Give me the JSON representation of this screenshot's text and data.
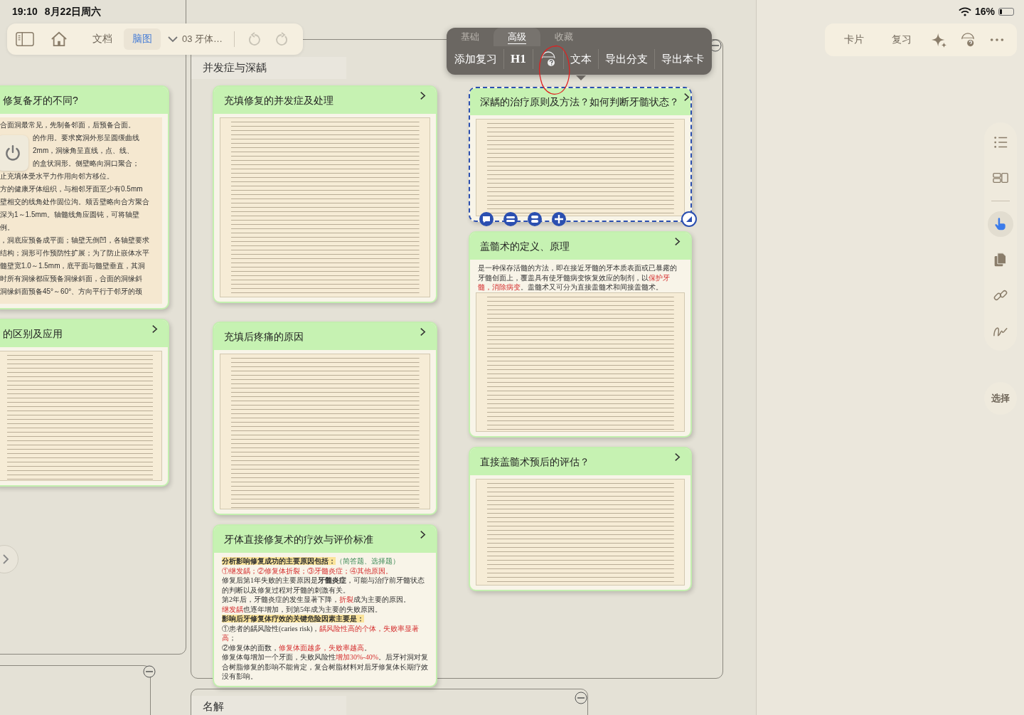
{
  "status_bar": {
    "time": "19:10",
    "date": "8月22日周六",
    "battery": "16%"
  },
  "toolbar": {
    "tabs": [
      {
        "label": "文档",
        "selected": false
      },
      {
        "label": "脑图",
        "selected": true
      }
    ],
    "document": "03 牙体…"
  },
  "format_popup": {
    "tabs": [
      {
        "label": "基础",
        "selected": false
      },
      {
        "label": "高级",
        "selected": true
      },
      {
        "label": "收藏",
        "selected": false
      }
    ],
    "actions": [
      {
        "kind": "text",
        "label": "添加复习"
      },
      {
        "kind": "heading",
        "label": "H1"
      },
      {
        "kind": "web"
      },
      {
        "kind": "text",
        "label": "文本"
      },
      {
        "kind": "text",
        "label": "导出分支"
      },
      {
        "kind": "text",
        "label": "导出本卡"
      }
    ]
  },
  "right_toolbar": {
    "buttons": [
      "卡片",
      "复习"
    ]
  },
  "side_tools": [
    {
      "kind": "list",
      "selected": false
    },
    {
      "kind": "layout",
      "selected": false
    },
    {
      "kind": "pointer",
      "selected": true
    },
    {
      "kind": "pages",
      "selected": false
    },
    {
      "kind": "link",
      "selected": false
    },
    {
      "kind": "draw",
      "selected": false
    }
  ],
  "select_button": "选择",
  "groups": [
    {
      "title": "并发症与深龋"
    },
    {
      "title": "名解"
    }
  ],
  "cards": [
    {
      "title": "修复备牙的不同?",
      "selected": false,
      "chevron": false,
      "kind": "lines",
      "lines": [
        "合面洞最常见，先制备邻面，后预备合面。",
        "的作用。要求窝洞外形呈圆缓曲线",
        "2mm，洞缘角呈直线，点、线、",
        "的盒状洞形。侧壁略向洞口聚合；",
        "止充填体受水平力作用向邻方移位。",
        "方的健康牙体组织，与相邻牙面至少有0.5mm",
        "壁相交的线角处作固位沟。颊舌壁略向合方聚合",
        "深为1～1.5mm。轴髓线角应圆钝，可将轴壁",
        "例。",
        "，洞底应预备成平面；轴壁无倒凹，各轴壁要求",
        "结构；洞形可作预防性扩展；为了防止嵌体水平",
        "髓壁宽1.0～1.5mm，底平面与髓壁垂直，其洞",
        "时所有洞缘都应预备洞缘斜面，合面的洞缘斜",
        "洞缘斜面预备45°～60°、方向平行于邻牙的颈"
      ]
    },
    {
      "title": "的区别及应用",
      "selected": false,
      "chevron": true,
      "kind": "document"
    },
    {
      "title": "充填修复的并发症及处理",
      "selected": false,
      "chevron": true,
      "kind": "document"
    },
    {
      "title": "充填后疼痛的原因",
      "selected": false,
      "chevron": true,
      "kind": "document"
    },
    {
      "title": "牙体直接修复术的疗效与评价标准",
      "selected": false,
      "chevron": true,
      "kind": "rich",
      "paragraphs": [
        [
          {
            "kind": "mark",
            "text": "分析影响修复成功的主要原因包括："
          },
          {
            "kind": "green",
            "text": "（简答题、选择题）"
          }
        ],
        [
          {
            "kind": "red",
            "text": "①继发龋；②修复体折裂；③牙髓炎症；④其他原因。"
          }
        ],
        [
          {
            "kind": "plain",
            "text": "修复后第1年失败的主要原因是"
          },
          {
            "kind": "bold",
            "text": "牙髓炎症"
          },
          {
            "kind": "plain",
            "text": "，可能与治疗前牙髓状态的判断以及修复过程对牙髓的刺激有关。"
          }
        ],
        [
          {
            "kind": "plain",
            "text": "第2年后，牙髓炎症的发生显著下降，"
          },
          {
            "kind": "red",
            "text": "折裂"
          },
          {
            "kind": "plain",
            "text": "成为主要的原因。"
          }
        ],
        [
          {
            "kind": "red",
            "text": "继发龋"
          },
          {
            "kind": "plain",
            "text": "也逐年增加，到第5年成为主要的失败原因。"
          }
        ],
        [
          {
            "kind": "mark",
            "text": "影响后牙修复体疗效的关键危险因素主要是："
          }
        ],
        [
          {
            "kind": "plain",
            "text": "①患者的龋风险性(caries risk)，"
          },
          {
            "kind": "red",
            "text": "龋风险性高的个体，失败率显著高"
          },
          {
            "kind": "plain",
            "text": "；"
          }
        ],
        [
          {
            "kind": "plain",
            "text": "②修复体的面数，"
          },
          {
            "kind": "red",
            "text": "修复体面越多，失败率越高"
          },
          {
            "kind": "plain",
            "text": "。"
          }
        ],
        [
          {
            "kind": "plain",
            "text": "修复体每增加一个牙面，失败风险性"
          },
          {
            "kind": "red",
            "text": "增加30%-40%"
          },
          {
            "kind": "plain",
            "text": "。后牙衬洞对复合树脂修复的影响不能肯定，复合树脂材料对后牙修复体长期疗效没有影响。"
          }
        ]
      ]
    },
    {
      "title": "深龋的治疗原则及方法？如何判断牙髓状态？",
      "selected": true,
      "chevron": true,
      "kind": "document"
    },
    {
      "title": "盖髓术的定义、原理",
      "selected": false,
      "chevron": true,
      "kind": "rich_document",
      "paragraphs": [
        [
          {
            "kind": "plain",
            "text": "是一种保存活髓的方法，即在接近牙髓的牙本质表面或已暴露的牙髓创面上，覆盖具有使牙髓病变恢复效应的制剂，以"
          },
          {
            "kind": "red",
            "text": "保护牙髓，消除病变"
          },
          {
            "kind": "plain",
            "text": "。盖髓术又可分为直接盖髓术和间接盖髓术。"
          }
        ]
      ]
    },
    {
      "title": "直接盖髓术预后的评估？",
      "selected": false,
      "chevron": true,
      "kind": "document"
    }
  ]
}
